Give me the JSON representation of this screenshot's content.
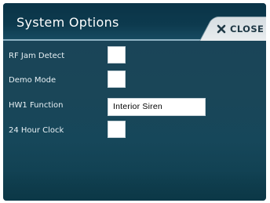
{
  "header": {
    "title": "System Options",
    "close_label": "CLOSE",
    "close_icon": "close-x-icon"
  },
  "options": {
    "rf_jam_detect": {
      "label": "RF Jam Detect",
      "checked": false
    },
    "demo_mode": {
      "label": "Demo Mode",
      "checked": false
    },
    "hw1_function": {
      "label": "HW1 Function",
      "value": "Interior Siren"
    },
    "hour_clock_24": {
      "label": "24 Hour Clock",
      "checked": false
    }
  },
  "colors": {
    "background": "#1a4658",
    "header": "#0d3a4e",
    "close_button": "#e2e7ea",
    "text": "#e8f1f5"
  }
}
